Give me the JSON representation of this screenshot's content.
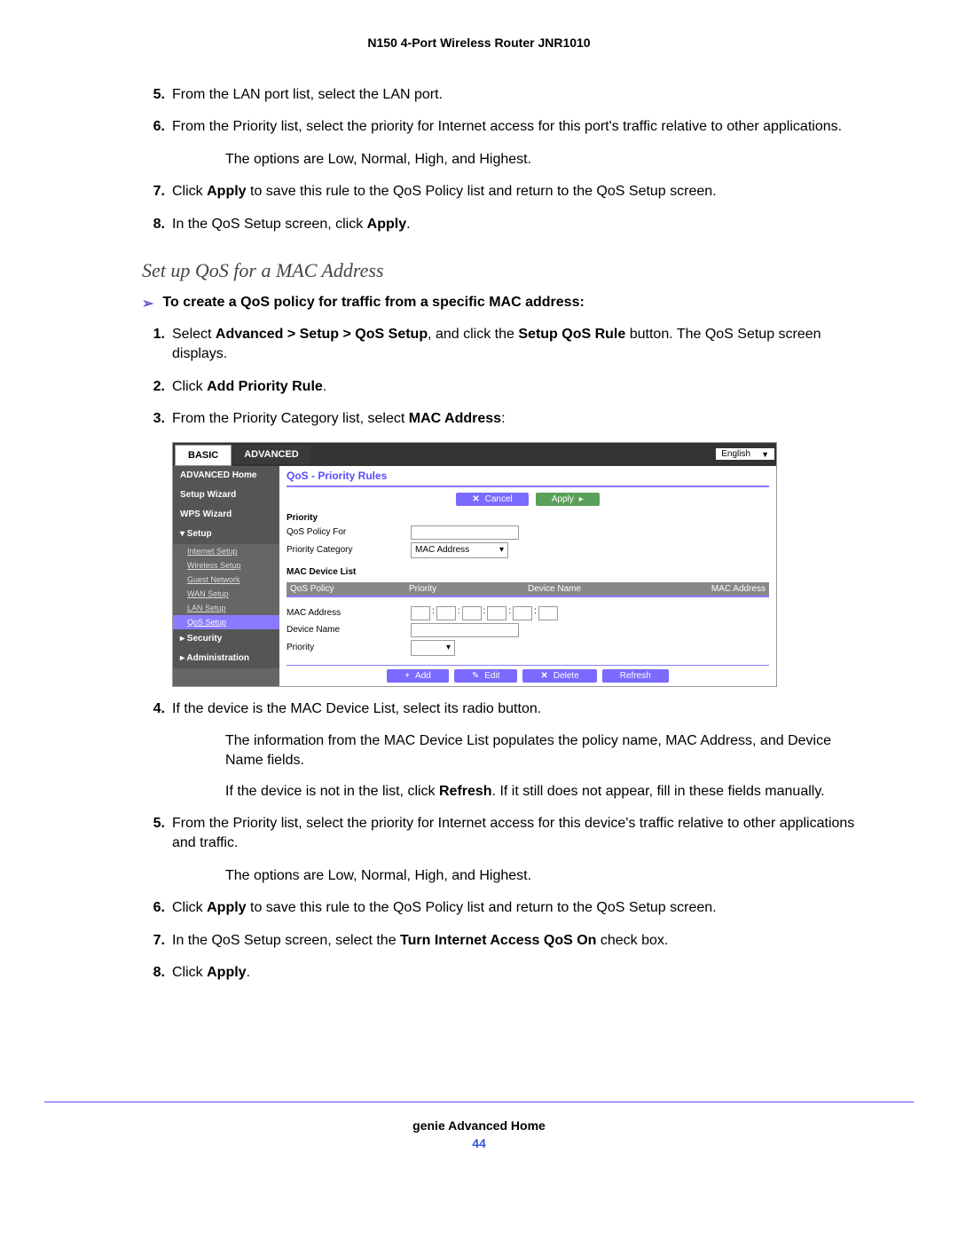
{
  "header": "N150 4-Port Wireless Router JNR1010",
  "steps_a": {
    "s5": {
      "n": "5.",
      "t": "From the LAN port list, select the LAN port."
    },
    "s6": {
      "n": "6.",
      "t": "From the Priority list, select the priority for Internet access for this port's traffic relative to other applications."
    },
    "s6b": "The options are Low, Normal, High, and Highest.",
    "s7": {
      "n": "7.",
      "p1": "Click ",
      "b": "Apply",
      "p2": " to save this rule to the QoS Policy list and return to the QoS Setup screen."
    },
    "s8": {
      "n": "8.",
      "p1": "In the QoS Setup screen, click ",
      "b": "Apply",
      "p2": "."
    }
  },
  "h2": "Set up QoS for a MAC Address",
  "lead": "To create a QoS policy for traffic from a specific MAC address:",
  "steps_b": {
    "s1": {
      "n": "1.",
      "p1": "Select ",
      "b1": "Advanced > Setup > QoS Setup",
      "p2": ", and click the ",
      "b2": "Setup QoS Rule",
      "p3": " button. The QoS Setup screen displays."
    },
    "s2": {
      "n": "2.",
      "p1": "Click ",
      "b": "Add Priority Rule",
      "p2": "."
    },
    "s3": {
      "n": "3.",
      "p1": "From the Priority Category list, select ",
      "b": "MAC Address",
      "p2": ":"
    }
  },
  "shot": {
    "tab_basic": "BASIC",
    "tab_adv": "ADVANCED",
    "lang": "English",
    "side": {
      "adv_home": "ADVANCED Home",
      "wiz": "Setup Wizard",
      "wps": "WPS Wizard",
      "setup": "▾ Setup",
      "internet": "Internet Setup",
      "wireless": "Wireless Setup",
      "guest": "Guest Network",
      "wan": "WAN Setup",
      "lan": "LAN Setup",
      "qos": "QoS Setup",
      "sec": "▸ Security",
      "adm": "▸ Administration"
    },
    "title": "QoS - Priority Rules",
    "btn_cancel": "Cancel",
    "btn_apply": "Apply",
    "prio_lbl": "Priority",
    "policy_for": "QoS Policy For",
    "prio_cat": "Priority Category",
    "prio_cat_val": "MAC Address",
    "list_title": "MAC Device List",
    "th_policy": "QoS Policy",
    "th_prio": "Priority",
    "th_dev": "Device Name",
    "th_mac": "MAC Address",
    "mac_lbl": "MAC Address",
    "dev_lbl": "Device Name",
    "prio2": "Priority",
    "b_add": "Add",
    "b_edit": "Edit",
    "b_del": "Delete",
    "b_ref": "Refresh"
  },
  "steps_c": {
    "s4": {
      "n": "4.",
      "t": "If the device is the MAC Device List, select its radio button."
    },
    "s4a": "The information from the MAC Device List populates the policy name, MAC Address, and Device Name fields.",
    "s4b": {
      "p1": "If the device is not in the list, click ",
      "b": "Refresh",
      "p2": ". If it still does not appear, fill in these fields manually."
    },
    "s5": {
      "n": "5.",
      "t": "From the Priority list, select the priority for Internet access for this device's traffic relative to other applications and traffic."
    },
    "s5a": "The options are Low, Normal, High, and Highest.",
    "s6": {
      "n": "6.",
      "p1": "Click ",
      "b": "Apply",
      "p2": " to save this rule to the QoS Policy list and return to the QoS Setup screen."
    },
    "s7": {
      "n": "7.",
      "p1": "In the QoS Setup screen, select the ",
      "b": "Turn Internet Access QoS On",
      "p2": " check box."
    },
    "s8": {
      "n": "8.",
      "p1": "Click ",
      "b": "Apply",
      "p2": "."
    }
  },
  "footer": {
    "t": "genie Advanced Home",
    "n": "44"
  }
}
